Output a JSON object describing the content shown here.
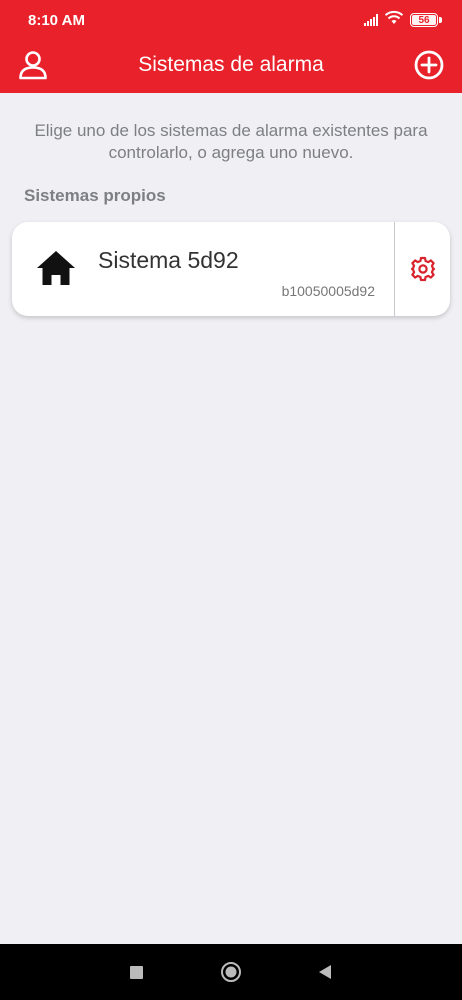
{
  "status_bar": {
    "time": "8:10 AM",
    "battery": "56",
    "icons": [
      "signal-icon",
      "wifi-icon",
      "battery-icon"
    ]
  },
  "app_bar": {
    "title": "Sistemas de alarma",
    "left_icon": "profile-icon",
    "right_icon": "add-circle-icon"
  },
  "content": {
    "intro": "Elige uno de los sistemas de alarma existentes para controlarlo, o agrega uno nuevo.",
    "section_label": "Sistemas propios",
    "systems": [
      {
        "name": "Sistema 5d92",
        "id": "b10050005d92",
        "icon": "home-icon",
        "action_icon": "gear-icon"
      }
    ]
  },
  "nav_bar": {
    "icons": [
      "recents-square-icon",
      "home-circle-icon",
      "back-triangle-icon"
    ]
  },
  "colors": {
    "brand_red": "#e8212b",
    "background": "#efeff4",
    "muted_text": "#7d7f85",
    "card_bg": "#ffffff"
  }
}
